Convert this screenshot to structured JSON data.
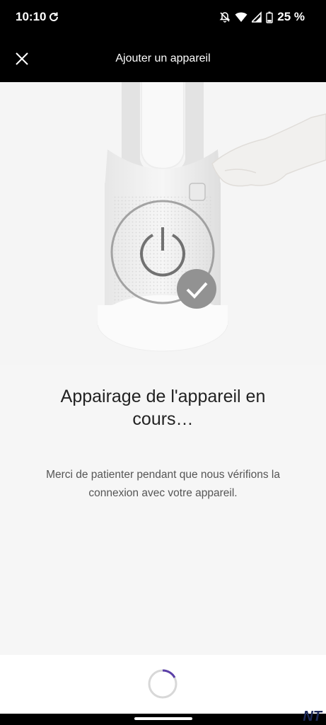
{
  "status_bar": {
    "time": "10:10",
    "battery": "25 %"
  },
  "app_bar": {
    "title": "Ajouter un appareil",
    "close_icon": "close-icon"
  },
  "content": {
    "heading": "Appairage de l'appareil en cours…",
    "message": "Merci de patienter pendant que nous vérifions la connexion avec votre appareil."
  },
  "icons": [
    "sync-icon",
    "bell-off-icon",
    "wifi-icon",
    "signal-icon",
    "battery-icon",
    "power-icon",
    "checkmark-icon",
    "remote-icon"
  ],
  "colors": {
    "spinner_accent": "#5b3fa8",
    "bar": "#000000",
    "background": "#f6f6f6"
  },
  "watermark": "NT"
}
